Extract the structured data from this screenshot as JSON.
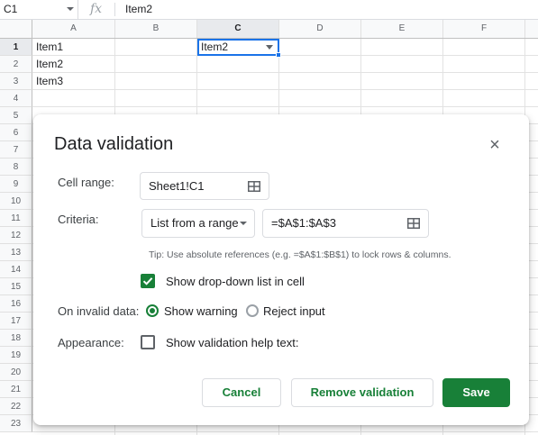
{
  "formula_bar": {
    "name_box": "C1",
    "fx": "fx",
    "value": "Item2"
  },
  "columns": [
    "A",
    "B",
    "C",
    "D",
    "E",
    "F"
  ],
  "rows": [
    "1",
    "2",
    "3",
    "4",
    "5",
    "6",
    "7",
    "8",
    "9",
    "10",
    "11",
    "12",
    "13",
    "14",
    "15",
    "16",
    "17",
    "18",
    "19",
    "20",
    "21",
    "22",
    "23"
  ],
  "cells": {
    "A1": "Item1",
    "A2": "Item2",
    "A3": "Item3",
    "C1": "Item2"
  },
  "dialog": {
    "title": "Data validation",
    "close_icon": "×",
    "cell_range_label": "Cell range:",
    "cell_range_value": "Sheet1!C1",
    "criteria_label": "Criteria:",
    "criteria_type": "List from a range",
    "criteria_range": "=$A$1:$A$3",
    "tip": "Tip: Use absolute references (e.g. =$A$1:$B$1) to lock rows & columns.",
    "show_dropdown_label": "Show drop-down list in cell",
    "show_dropdown_checked": true,
    "invalid_label": "On invalid data:",
    "show_warning_label": "Show warning",
    "reject_input_label": "Reject input",
    "selected_invalid_option": "Show warning",
    "appearance_label": "Appearance:",
    "help_text_label": "Show validation help text:",
    "help_text_checked": false,
    "cancel_label": "Cancel",
    "remove_label": "Remove validation",
    "save_label": "Save"
  },
  "colors": {
    "accent_green": "#188038",
    "selection_blue": "#1a73e8"
  }
}
